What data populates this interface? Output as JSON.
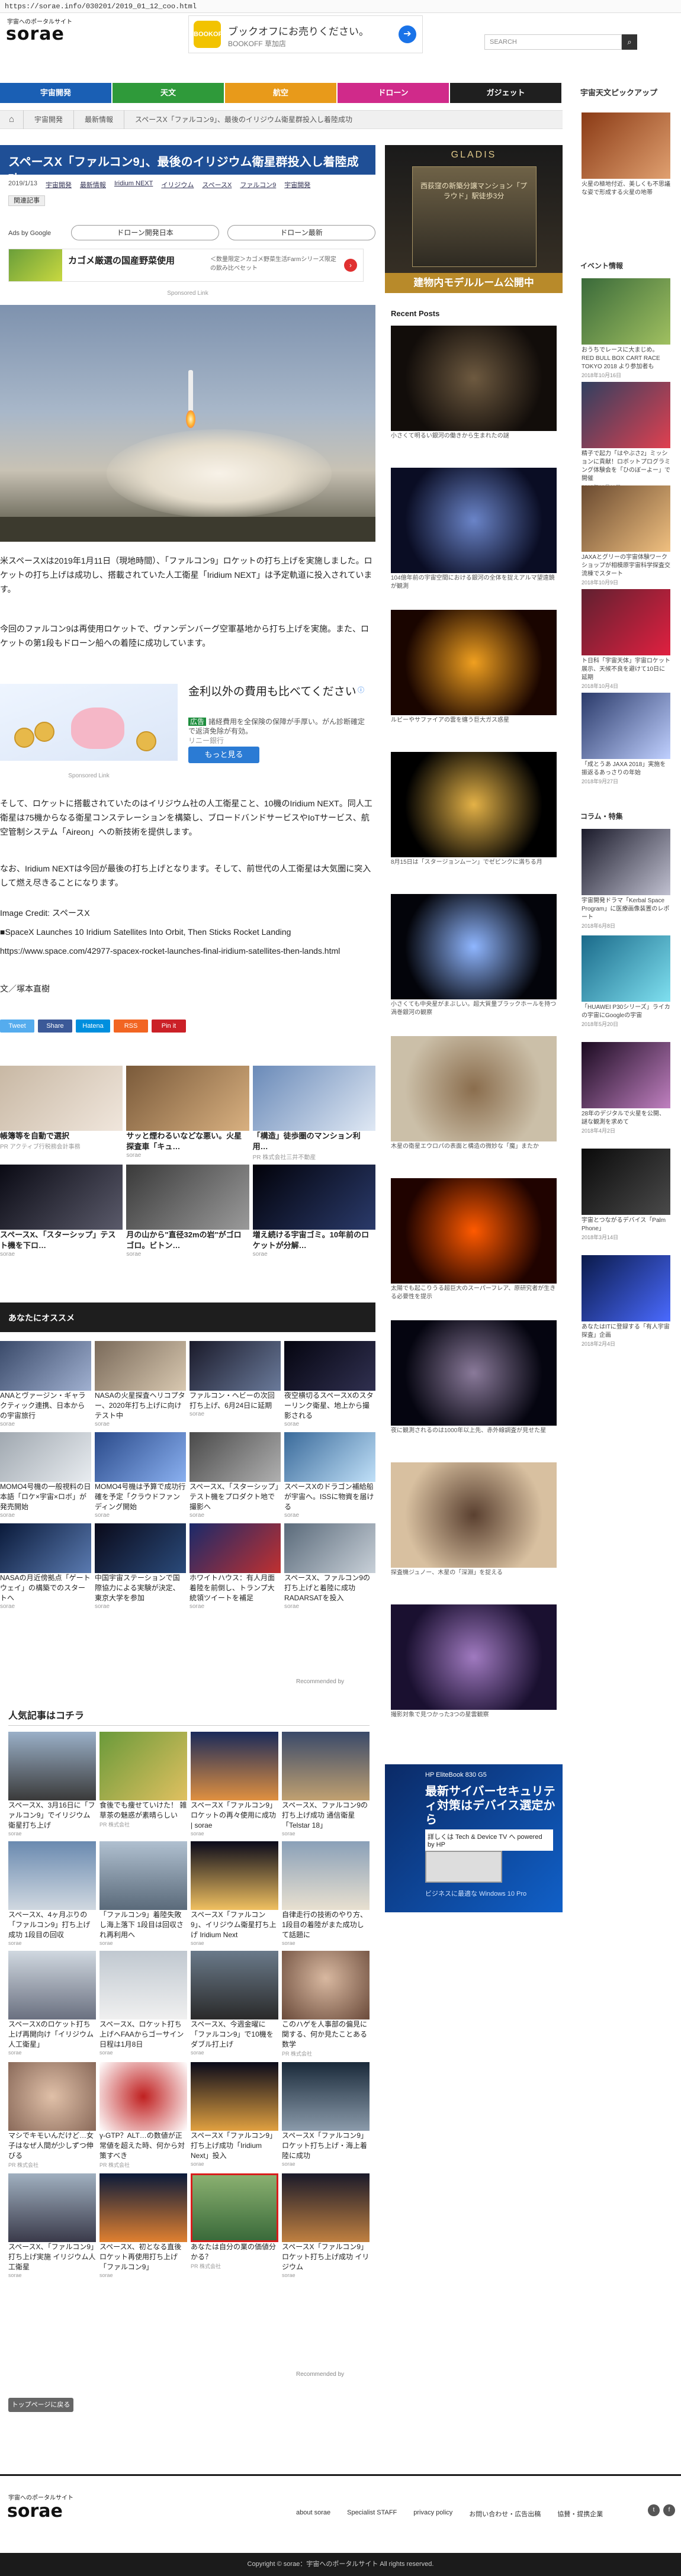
{
  "browser": {
    "url": "https://sorae.info/030201/2019_01_12_coo.html"
  },
  "site": {
    "logo_sub": "宇宙へのポータルサイト",
    "logo": "sorae",
    "search_placeholder": "SEARCH"
  },
  "header_ad": {
    "logo_text": "BOOKOFF",
    "title": "ブックオフにお売りください。",
    "sub": "BOOKOFF 草加店"
  },
  "nav": [
    {
      "label": "宇宙開発",
      "color": "#1a5fb4"
    },
    {
      "label": "天文",
      "color": "#2f9a3a"
    },
    {
      "label": "航空",
      "color": "#e89a1a"
    },
    {
      "label": "ドローン",
      "color": "#d02a8a"
    },
    {
      "label": "ガジェット",
      "color": "#1f1f1f"
    }
  ],
  "breadcrumb": [
    "宇宙開発",
    "最新情報",
    "スペースX「ファルコン9」、最後のイリジウム衛星群投入し着陸成功"
  ],
  "article": {
    "title": "スペースX「ファルコン9」、最後のイリジウム衛星群投入し着陸成功",
    "date": "2019/1/13",
    "tags": [
      "宇宙開発",
      "最新情報",
      "Iridium NEXT",
      "イリジウム",
      "スペースX",
      "ファルコン9",
      "宇宙開発"
    ],
    "follow_label": "関連記事",
    "paragraph1": "米スペースXは2019年1月11日（現地時間）、「ファルコン9」ロケットの打ち上げを実施しました。ロケットの打ち上げは成功し、搭載されていた人工衛星「Iridium NEXT」は予定軌道に投入されています。",
    "paragraph2": "今回のファルコン9は再使用ロケットで、ヴァンデンバーグ空軍基地から打ち上げを実施。また、ロケットの第1段もドローン船への着陸に成功しています。",
    "paragraph3": "そして、ロケットに搭載されていたのはイリジウム社の人工衛星こと、10機のIridium NEXT。同人工衛星は75機からなる衛星コンステレーションを構築し、ブロードバンドサービスやIoTサービス、航空管制システム「Aireon」への新技術を提供します。",
    "paragraph4": "なお、Iridium NEXTは今回が最後の打ち上げとなります。そして、前世代の人工衛星は大気圏に突入して燃え尽きることになります。",
    "image_credit": "Image Credit: スペースX",
    "source_title": "■SpaceX Launches 10 Iridium Satellites Into Orbit, Then Sticks Rocket Landing",
    "source_url": "https://www.space.com/42977-spacex-rocket-launches-final-iridium-satellites-then-lands.html",
    "author": "文／塚本直樹"
  },
  "ads_by_google": {
    "label": "Ads by Google",
    "chips": [
      "ドローン開発日本",
      "ドローン最新"
    ]
  },
  "mid_ad": {
    "headline": "カゴメ厳選の国産野菜使用",
    "body": "＜数量限定＞カゴメ野菜生活Farmシリーズ限定の飲み比べセット",
    "sponsored": "Sponsored Link"
  },
  "inline_ad": {
    "headline": "金利以外の費用も比べてください",
    "badge": "広告",
    "body": "諸経費用を全保険の保障が手厚い。がん診断確定で返済免除が有効。",
    "company": "リニー銀行",
    "cta": "もっと見る",
    "sponsored": "Sponsored Link"
  },
  "share": [
    {
      "label": "Tweet",
      "color": "#55acee"
    },
    {
      "label": "Share",
      "color": "#3b5998"
    },
    {
      "label": "Hatena",
      "color": "#008fde"
    },
    {
      "label": "RSS",
      "color": "#f26522"
    },
    {
      "label": "Pin it",
      "color": "#cb2027"
    }
  ],
  "promo_cards": [
    {
      "caption": "帳簿等を自動で選択",
      "source": "PR アクティブ行税務会計事務"
    },
    {
      "caption": "サッと煙わるいなどな悪い。火星探査車「キュ…",
      "source": "sorae"
    },
    {
      "caption": "「構造」徒歩圏のマンション利用…",
      "source": "PR 株式会社三井不動産"
    },
    {
      "caption": "スペースX、「スターシップ」テスト機を下ロ…",
      "source": "sorae"
    },
    {
      "caption": "月の山から\"直径32mの岩\"がゴロゴロ。ビトン…",
      "source": "sorae"
    },
    {
      "caption": "増え続ける宇宙ゴミ。10年前のロケットが分解…",
      "source": "sorae"
    }
  ],
  "recommend": {
    "title": "あなたにオススメ",
    "attribution": "Recommended by",
    "items": [
      {
        "caption": "ANAとヴァージン・ギャラクティック連携、日本からの宇宙旅行",
        "source": "sorae"
      },
      {
        "caption": "NASAの火星探査ヘリコプター、2020年打ち上げに向けテスト中",
        "source": "sorae"
      },
      {
        "caption": "ファルコン・ヘビーの次回打ち上げ、6月24日に延期",
        "source": "sorae"
      },
      {
        "caption": "夜空横切るスペースXのスターリンク衛星、地上から撮影される",
        "source": "sorae"
      },
      {
        "caption": "MOMO4号機の一般視料の日本語「ロケ×宇宙×ロボ」が発売開始",
        "source": "sorae"
      },
      {
        "caption": "MOMO4号機は予算で成功行確を予定「クラウドファンディング開始",
        "source": "sorae"
      },
      {
        "caption": "スペースX、「スターシップ」テスト機をプロダクト地で撮影へ",
        "source": "sorae"
      },
      {
        "caption": "スペースXのドラゴン補給船が宇宙へ。ISSに物資を届ける",
        "source": "sorae"
      },
      {
        "caption": "NASAの月近傍拠点「ゲートウェイ」の構築でのスタートへ",
        "source": "sorae"
      },
      {
        "caption": "中国宇宙ステーションで国際協力による実験が決定、東京大学を参加",
        "source": "sorae"
      },
      {
        "caption": "ホワイトハウス：有人月面着陸を前倒し、トランプ大統領ツイートを補足",
        "source": "sorae"
      },
      {
        "caption": "スペースX、ファルコン9の打ち上げと着陸に成功 RADARSATを投入",
        "source": "sorae"
      }
    ]
  },
  "popular": {
    "title": "人気記事はコチラ",
    "attribution": "Recommended by",
    "items": [
      {
        "caption": "スペースX、3月16日に「ファルコン9」でイリジウム衛星打ち上げ",
        "source": "sorae"
      },
      {
        "caption": "食後でも痩せていけた！ 雑草茶の魅惑が素晴らしい",
        "source": "PR 株式会社"
      },
      {
        "caption": "スペースX「ファルコン9」ロケットの再々使用に成功 | sorae",
        "source": "sorae"
      },
      {
        "caption": "スペースX、ファルコン9の打ち上げ成功 通信衛星「Telstar 18」",
        "source": "sorae"
      },
      {
        "caption": "スペースX、4ヶ月ぶりの「ファルコン9」打ち上げ成功 1段目の回収",
        "source": "sorae"
      },
      {
        "caption": "「ファルコン9」着陸失敗し海上落下 1段目は回収され再利用へ",
        "source": "sorae"
      },
      {
        "caption": "スペースX「ファルコン9」、イリジウム衛星打ち上げ Iridium Next",
        "source": "sorae"
      },
      {
        "caption": "自律走行の技術のやり方、1段目の着陸がまた成功して話題に",
        "source": "sorae"
      },
      {
        "caption": "スペースXのロケット打ち上げ再開向け「イリジウム人工衛星」",
        "source": "sorae"
      },
      {
        "caption": "スペースX、ロケット打ち上げへFAAからゴーサイン 日程は1月8日",
        "source": "sorae"
      },
      {
        "caption": "スペースX、今週金曜に「ファルコン9」で10機をダブル打上げ",
        "source": "sorae"
      },
      {
        "caption": "このハゲを人事部の偏見に関する、何か見たことある数学",
        "source": "PR 株式会社"
      },
      {
        "caption": "マシでキモいんだけど…女子はなぜ人間が少しずつ伸びる",
        "source": "PR 株式会社"
      },
      {
        "caption": "γ-GTP？ALT…の数値が正常値を超えた時、何から対策すべき",
        "source": "PR 株式会社"
      },
      {
        "caption": "スペースX「ファルコン9」打ち上げ成功「Iridium Next」投入",
        "source": "sorae"
      },
      {
        "caption": "スペースX「ファルコン9」ロケット打ち上げ・海上着陸に成功",
        "source": "sorae"
      },
      {
        "caption": "スペースX、「ファルコン9」打ち上げ実施 イリジウム人工衛星",
        "source": "sorae"
      },
      {
        "caption": "スペースX、初となる直後ロケット再使用打ち上げ「ファルコン9」",
        "source": "sorae"
      },
      {
        "caption": "あなたは自分の業の価値分かる？",
        "source": "PR 株式会社"
      },
      {
        "caption": "スペースX「ファルコン9」ロケット打ち上げ成功 イリジウム",
        "source": "sorae"
      }
    ]
  },
  "back_button": "トップページに戻る",
  "gladis_ad": {
    "brand": "GLADIS",
    "body": "西荻窪の新築分譲マンション「プラウド」駅徒歩3分",
    "bar": "建物内モデルルーム公開中"
  },
  "recent_posts": {
    "title": "Recent Posts",
    "items": [
      {
        "caption": "小さくて明るい銀河の働きから生まれたの謎",
        "colors": [
          "#120d0a",
          "#6e5a40"
        ]
      },
      {
        "caption": "104億年前の宇宙空間における銀河の全体を捉えアルマ望遠鏡が観測",
        "colors": [
          "#0a0d24",
          "#6a84c8"
        ]
      },
      {
        "caption": "ルビーやサファイアの雲を纏う巨大ガス惑星",
        "colors": [
          "#1a0500",
          "#f0a020"
        ]
      },
      {
        "caption": "8月15日は「スタージョンムーン」でゼビンクに満ちる月",
        "colors": [
          "#000000",
          "#e4b247"
        ]
      },
      {
        "caption": "小さくても中央星がまぶしい。超大質量ブラックホールを持つ渦巻銀河の観察",
        "colors": [
          "#03040a",
          "#8fb6ff"
        ]
      },
      {
        "caption": "木星の衛星エウロパの表面と構造の微妙な「魔」またか",
        "colors": [
          "#cbbfa8",
          "#8a6d4d"
        ]
      },
      {
        "caption": "太陽でも起こりうる超巨大のスーパーフレア、原研究者が生きる必要性を提示",
        "colors": [
          "#200300",
          "#ff5a00"
        ]
      },
      {
        "caption": "夜に観測されるのは1000年以上先、赤外線調査が見せた星",
        "colors": [
          "#050510",
          "#8a7a9a"
        ]
      },
      {
        "caption": "探査機ジュノー、木星の「深淵」を捉える",
        "colors": [
          "#d8c0a0",
          "#5a4030"
        ]
      },
      {
        "caption": "撮影対象で見つかった3つの星雲観察",
        "colors": [
          "#1a1030",
          "#a07ac0"
        ]
      }
    ]
  },
  "hp_ad": {
    "line1": "HP EliteBook 830 G5",
    "line2": "最新サイバーセキュリティ対策はデバイス選定から",
    "line3": "詳しくは Tech & Device TV へ powered by HP",
    "line4": "ビジネスに最適な Windows 10 Pro"
  },
  "right_sidebar": {
    "pickup_title": "宇宙天文ピックアップ",
    "pickup": {
      "caption": "火星の極地付近、美しくも不思議な姿で形成する火星の地帯",
      "colors": [
        "#8a3a15",
        "#e0a070"
      ]
    },
    "events_title": "イベント情報",
    "events": [
      {
        "caption": "おうちでレースに大まじめ。RED BULL BOX CART RACE TOKYO 2018 より参加者も",
        "date": "2018年10月16日",
        "colors": [
          "#3a6a3a",
          "#a0c060"
        ]
      },
      {
        "caption": "精子で起力「はやぶさ2」ミッションに貢献！ロボットプログラミング体験会を「ひのぼーよー」で開催",
        "date": "2018年10月11日",
        "colors": [
          "#304060",
          "#e04050"
        ]
      },
      {
        "caption": "JAXAとグリーの宇宙体験ワークショップが相模原宇宙科学探査交流棟でスタート",
        "date": "2018年10月9日",
        "colors": [
          "#6a4a30",
          "#f0c080"
        ]
      },
      {
        "caption": "ト日科「宇宙天体」宇宙ロケット展示、天候不良を避けて10日に延期",
        "date": "2018年10月4日",
        "colors": [
          "#602030",
          "#e02040"
        ]
      },
      {
        "caption": "「成とうあ JAXA 2018」実施を振返るあっさりの年始",
        "date": "2018年9月27日",
        "colors": [
          "#2a3a6a",
          "#c0d0ff"
        ]
      }
    ],
    "column_title": "コラム・特集",
    "columns": [
      {
        "caption": "宇宙開発ドラマ「Kerbal Space Program」に医療画像装置のレポート",
        "date": "2018年6月8日",
        "colors": [
          "#1a1a2a",
          "#c0c0d0"
        ]
      },
      {
        "caption": "「HUAWEI P30シリーズ」ライカの宇宙にGoogleの宇宙",
        "date": "2018年5月20日",
        "colors": [
          "#1a6a8a",
          "#7fe0f0"
        ]
      },
      {
        "caption": "28年のデジタルで火星を公開、謎な観測を求めて",
        "date": "2018年4月2日",
        "colors": [
          "#1a0a20",
          "#c080c0"
        ]
      },
      {
        "caption": "宇宙とつながるデバイス「Palm Phone」",
        "date": "2018年3月14日",
        "colors": [
          "#0a0a0a",
          "#4a4a4a"
        ]
      },
      {
        "caption": "あなたはITに登録する「有人宇宙探査」企画",
        "date": "2018年2月4日",
        "colors": [
          "#0a1a4a",
          "#4a6aff"
        ]
      }
    ]
  },
  "footer": {
    "logo_sub": "宇宙へのポータルサイト",
    "logo": "sorae",
    "links": [
      "about sorae",
      "Specialist STAFF",
      "privacy policy",
      "お問い合わせ・広告出稿",
      "協賛・提携企業"
    ],
    "copyright": "Copyright © sorae：宇宙へのポータルサイト All rights reserved."
  }
}
